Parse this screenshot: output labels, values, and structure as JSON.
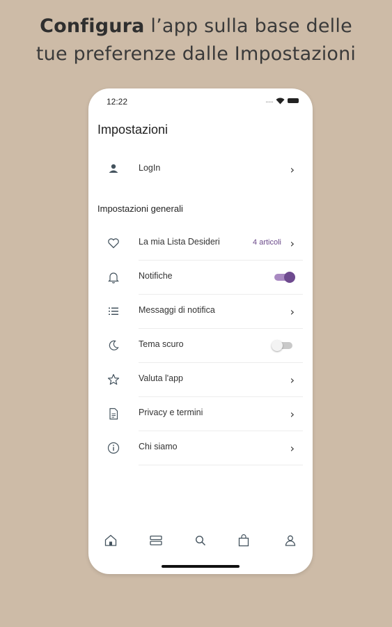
{
  "headline": {
    "bold": "Configura",
    "line1_rest": " l’app sulla base delle",
    "line2": "tue preferenze dalle Impostazioni"
  },
  "status": {
    "time": "12:22",
    "dots": "....."
  },
  "page_title": "Impostazioni",
  "login": {
    "label": "LogIn",
    "icon": "user-icon"
  },
  "section_title": "Impostazioni generali",
  "items": [
    {
      "label": "La mia Lista Desideri",
      "badge": "4 articoli",
      "icon": "heart-icon",
      "control": "chevron"
    },
    {
      "label": "Notifiche",
      "icon": "bell-icon",
      "control": "toggle",
      "toggle_state": "on"
    },
    {
      "label": "Messaggi di notifica",
      "icon": "list-icon",
      "control": "chevron"
    },
    {
      "label": "Tema scuro",
      "icon": "moon-icon",
      "control": "toggle",
      "toggle_state": "off"
    },
    {
      "label": "Valuta l'app",
      "icon": "star-icon",
      "control": "chevron"
    },
    {
      "label": "Privacy e termini",
      "icon": "document-icon",
      "control": "chevron"
    },
    {
      "label": "Chi siamo",
      "icon": "info-icon",
      "control": "chevron"
    }
  ],
  "tabbar": [
    "home-icon",
    "categories-icon",
    "search-icon",
    "bag-icon",
    "profile-icon"
  ],
  "colors": {
    "background": "#cdbba7",
    "accent": "#6e4a8f",
    "icon": "#44535e"
  }
}
